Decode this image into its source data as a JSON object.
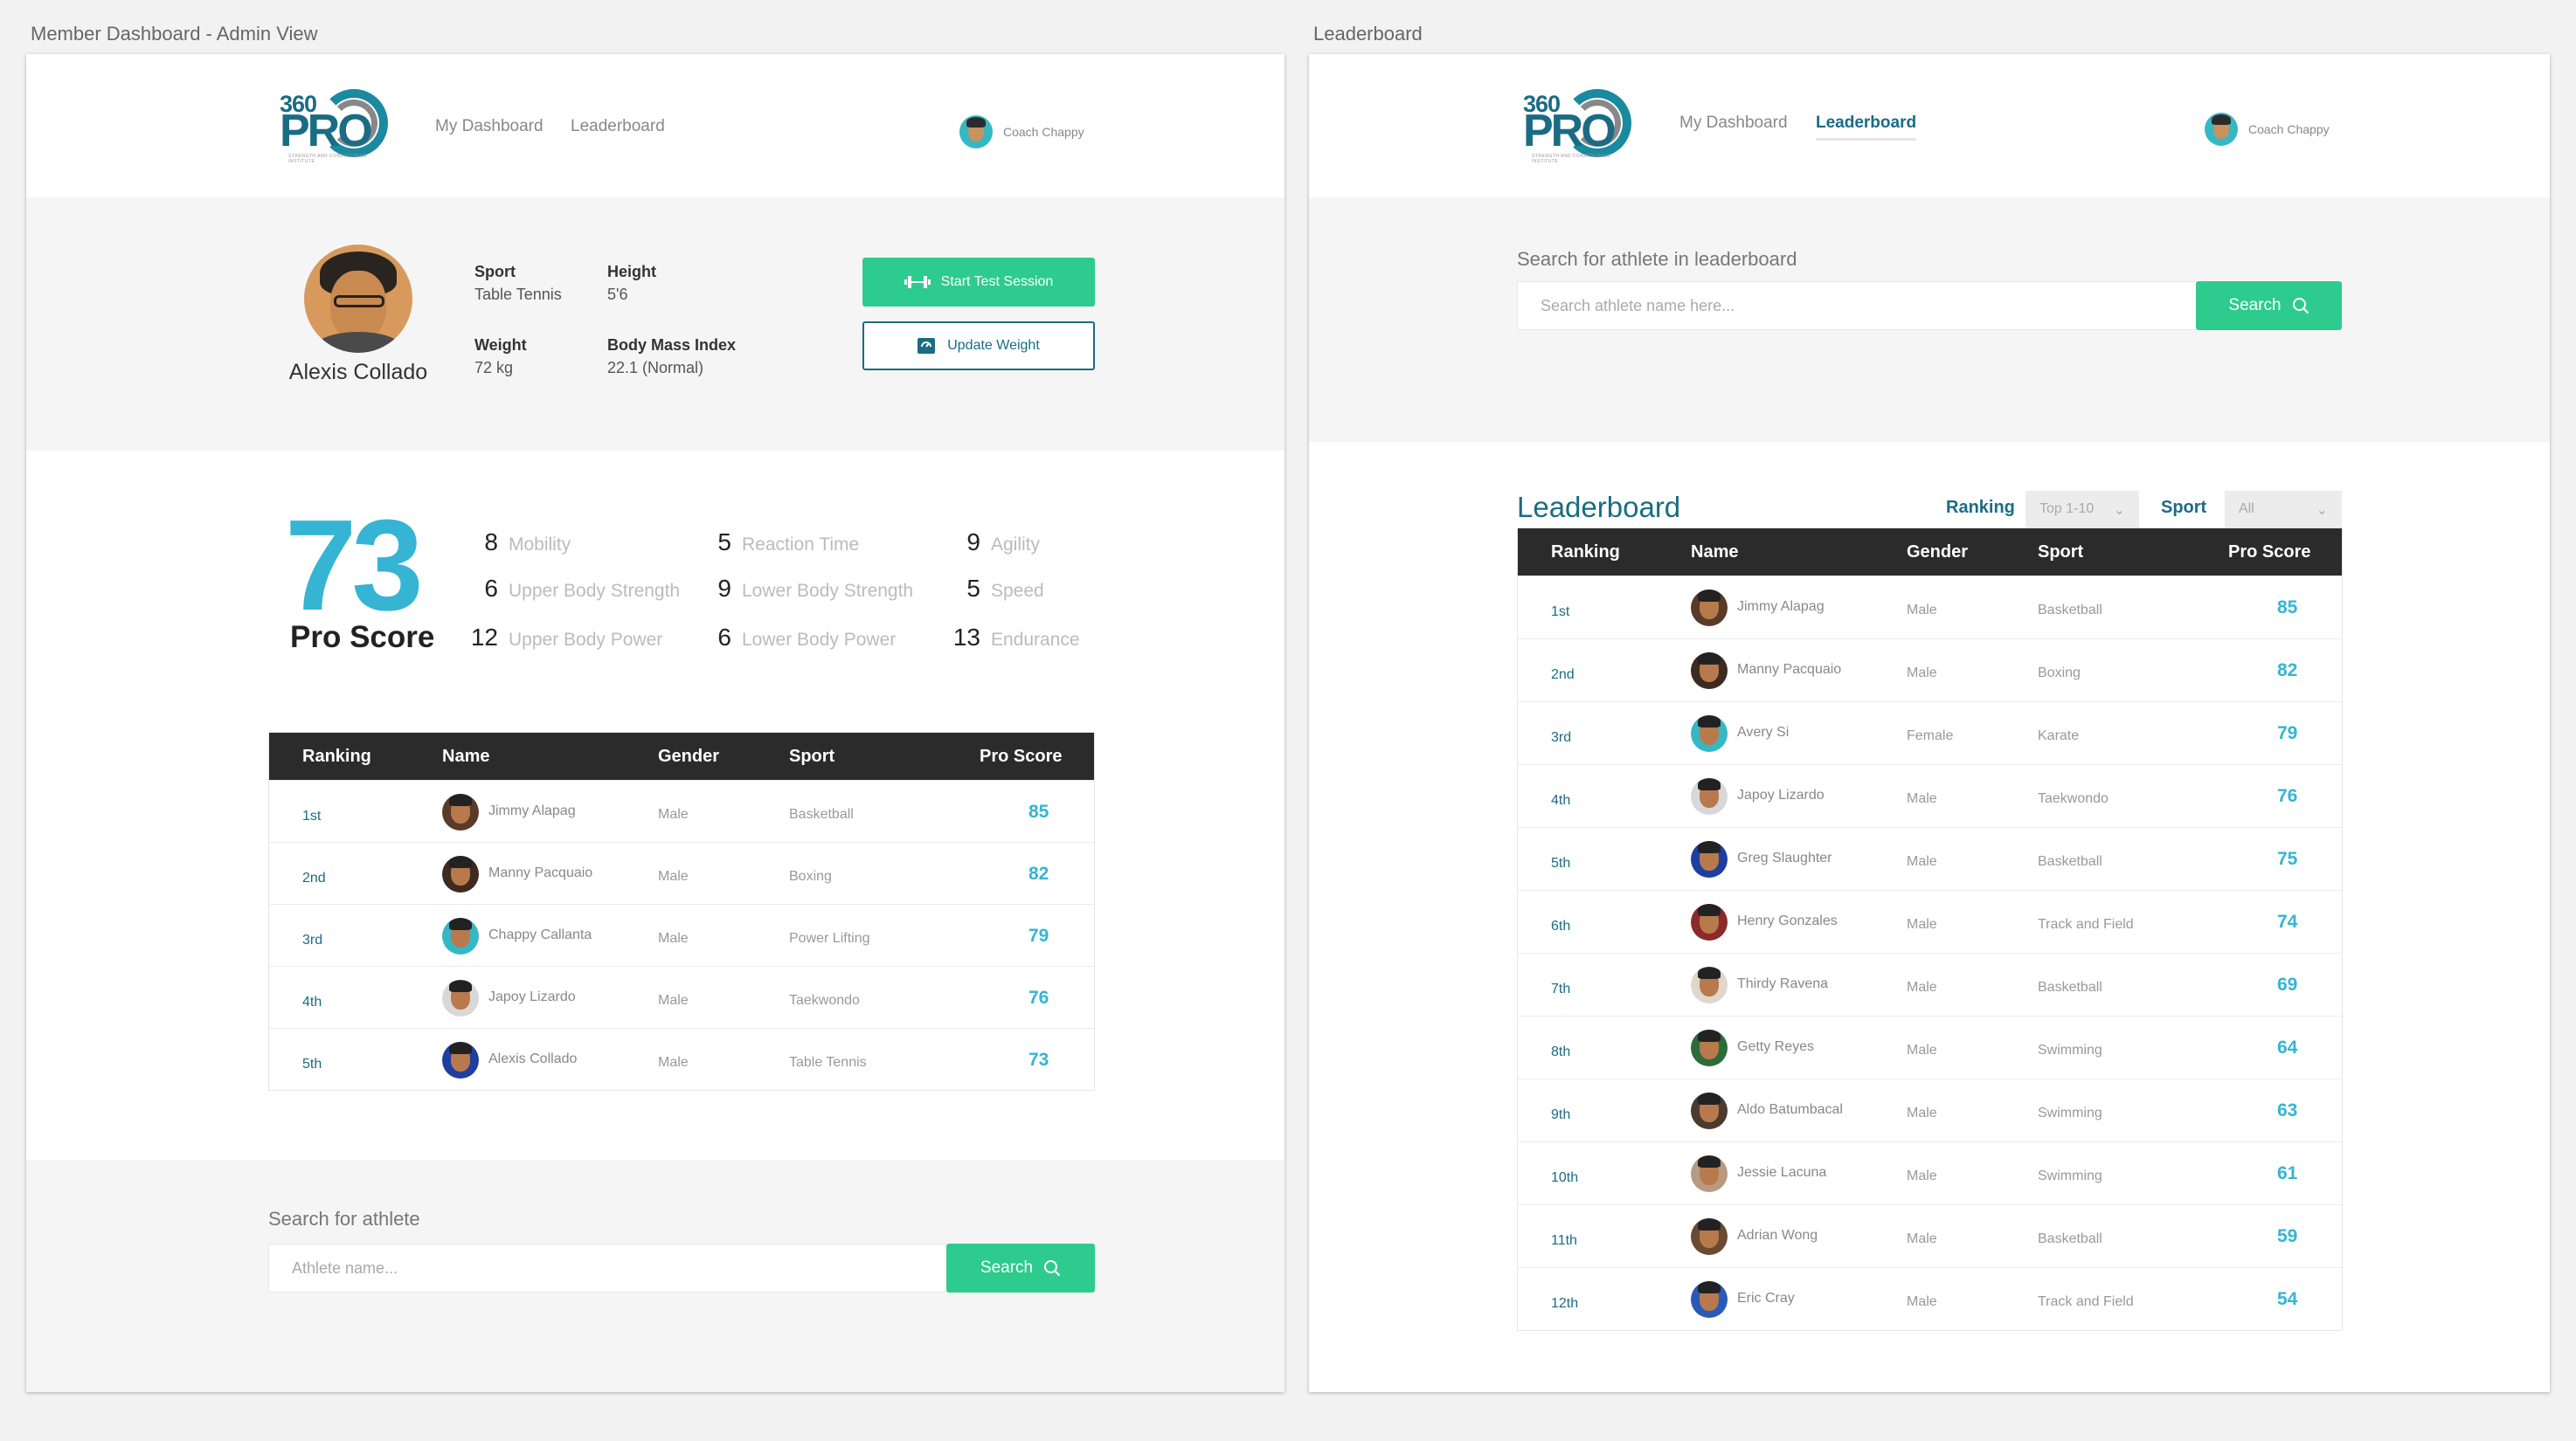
{
  "artboards": {
    "left_title": "Member Dashboard - Admin View",
    "right_title": "Leaderboard"
  },
  "header": {
    "logo": {
      "top": "360",
      "main": "PRO",
      "sub": "STRENGTH AND CONDITIONING INSTITUTE"
    },
    "nav": {
      "dashboard": "My Dashboard",
      "leaderboard": "Leaderboard"
    },
    "user_name": "Coach Chappy"
  },
  "profile": {
    "name": "Alexis Collado",
    "sport_label": "Sport",
    "sport": "Table Tennis",
    "height_label": "Height",
    "height": "5'6",
    "weight_label": "Weight",
    "weight": "72 kg",
    "bmi_label": "Body Mass Index",
    "bmi": "22.1 (Normal)",
    "start_button": "Start Test Session",
    "update_button": "Update Weight"
  },
  "pro_score": {
    "value": "73",
    "label": "Pro Score",
    "metrics": [
      {
        "value": "8",
        "label": "Mobility"
      },
      {
        "value": "5",
        "label": "Reaction Time"
      },
      {
        "value": "9",
        "label": "Agility"
      },
      {
        "value": "6",
        "label": "Upper Body Strength"
      },
      {
        "value": "9",
        "label": "Lower Body Strength"
      },
      {
        "value": "5",
        "label": "Speed"
      },
      {
        "value": "12",
        "label": "Upper Body Power"
      },
      {
        "value": "6",
        "label": "Lower Body Power"
      },
      {
        "value": "13",
        "label": "Endurance"
      }
    ]
  },
  "table_headers": {
    "ranking": "Ranking",
    "name": "Name",
    "gender": "Gender",
    "sport": "Sport",
    "score": "Pro Score"
  },
  "mini_table": [
    {
      "rank": "1st",
      "name": "Jimmy Alapag",
      "gender": "Male",
      "sport": "Basketball",
      "score": "85"
    },
    {
      "rank": "2nd",
      "name": "Manny Pacquaio",
      "gender": "Male",
      "sport": "Boxing",
      "score": "82"
    },
    {
      "rank": "3rd",
      "name": "Chappy Callanta",
      "gender": "Male",
      "sport": "Power Lifting",
      "score": "79"
    },
    {
      "rank": "4th",
      "name": "Japoy Lizardo",
      "gender": "Male",
      "sport": "Taekwondo",
      "score": "76"
    },
    {
      "rank": "5th",
      "name": "Alexis Collado",
      "gender": "Male",
      "sport": "Table Tennis",
      "score": "73"
    }
  ],
  "search_athlete": {
    "label": "Search for athlete",
    "placeholder": "Athlete name...",
    "button": "Search"
  },
  "leaderboard": {
    "search_label": "Search for athlete in leaderboard",
    "search_placeholder": "Search athlete name here...",
    "search_button": "Search",
    "title": "Leaderboard",
    "ranking_filter_label": "Ranking",
    "ranking_filter_value": "Top 1-10",
    "sport_filter_label": "Sport",
    "sport_filter_value": "All",
    "rows": [
      {
        "rank": "1st",
        "name": "Jimmy Alapag",
        "gender": "Male",
        "sport": "Basketball",
        "score": "85"
      },
      {
        "rank": "2nd",
        "name": "Manny Pacquaio",
        "gender": "Male",
        "sport": "Boxing",
        "score": "82"
      },
      {
        "rank": "3rd",
        "name": "Avery Si",
        "gender": "Female",
        "sport": "Karate",
        "score": "79"
      },
      {
        "rank": "4th",
        "name": "Japoy Lizardo",
        "gender": "Male",
        "sport": "Taekwondo",
        "score": "76"
      },
      {
        "rank": "5th",
        "name": "Greg Slaughter",
        "gender": "Male",
        "sport": "Basketball",
        "score": "75"
      },
      {
        "rank": "6th",
        "name": "Henry Gonzales",
        "gender": "Male",
        "sport": "Track and Field",
        "score": "74"
      },
      {
        "rank": "7th",
        "name": "Thirdy Ravena",
        "gender": "Male",
        "sport": "Basketball",
        "score": "69"
      },
      {
        "rank": "8th",
        "name": "Getty Reyes",
        "gender": "Male",
        "sport": "Swimming",
        "score": "64"
      },
      {
        "rank": "9th",
        "name": "Aldo Batumbacal",
        "gender": "Male",
        "sport": "Swimming",
        "score": "63"
      },
      {
        "rank": "10th",
        "name": "Jessie Lacuna",
        "gender": "Male",
        "sport": "Swimming",
        "score": "61"
      },
      {
        "rank": "11th",
        "name": "Adrian Wong",
        "gender": "Male",
        "sport": "Basketball",
        "score": "59"
      },
      {
        "rank": "12th",
        "name": "Eric Cray",
        "gender": "Male",
        "sport": "Track and Field",
        "score": "54"
      }
    ]
  },
  "colors": {
    "brand": "#1a6c84",
    "accent_green": "#2ecb8e",
    "score_blue": "#35b5d3",
    "table_header": "#2b2b2b",
    "band_bg": "#f5f5f5"
  },
  "icons": {
    "start_button": "dumbbell-icon",
    "update_button": "scale-icon",
    "search_button": "search-icon",
    "filter": "chevron-down-icon"
  }
}
